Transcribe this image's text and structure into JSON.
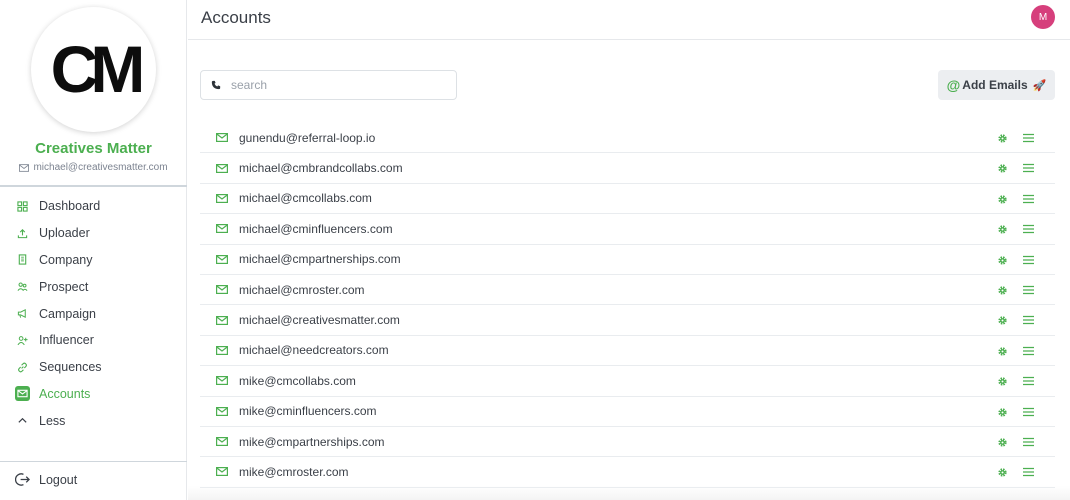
{
  "brand": {
    "logo_text": "CM",
    "name": "Creatives Matter",
    "email": "michael@creativesmatter.com"
  },
  "nav": {
    "items": [
      {
        "label": "Dashboard",
        "icon": "dashboard-icon",
        "active": false
      },
      {
        "label": "Uploader",
        "icon": "upload-icon",
        "active": false
      },
      {
        "label": "Company",
        "icon": "building-icon",
        "active": false
      },
      {
        "label": "Prospect",
        "icon": "people-icon",
        "active": false
      },
      {
        "label": "Campaign",
        "icon": "megaphone-icon",
        "active": false
      },
      {
        "label": "Influencer",
        "icon": "user-plus-icon",
        "active": false
      },
      {
        "label": "Sequences",
        "icon": "link-icon",
        "active": false
      },
      {
        "label": "Accounts",
        "icon": "mail-icon",
        "active": true
      },
      {
        "label": "Less",
        "icon": "chevron-up-icon",
        "active": false
      }
    ],
    "logout_label": "Logout"
  },
  "header": {
    "title": "Accounts",
    "avatar_initial": "M"
  },
  "search": {
    "placeholder": "search",
    "value": ""
  },
  "actions": {
    "add_emails_label": "Add Emails"
  },
  "accounts": [
    "gunendu@referral-loop.io",
    "michael@cmbrandcollabs.com",
    "michael@cmcollabs.com",
    "michael@cminfluencers.com",
    "michael@cmpartnerships.com",
    "michael@cmroster.com",
    "michael@creativesmatter.com",
    "michael@needcreators.com",
    "mike@cmcollabs.com",
    "mike@cminfluencers.com",
    "mike@cmpartnerships.com",
    "mike@cmroster.com"
  ],
  "colors": {
    "accent": "#4caf50",
    "avatar": "#d63f7c",
    "text": "#3a3f47"
  }
}
